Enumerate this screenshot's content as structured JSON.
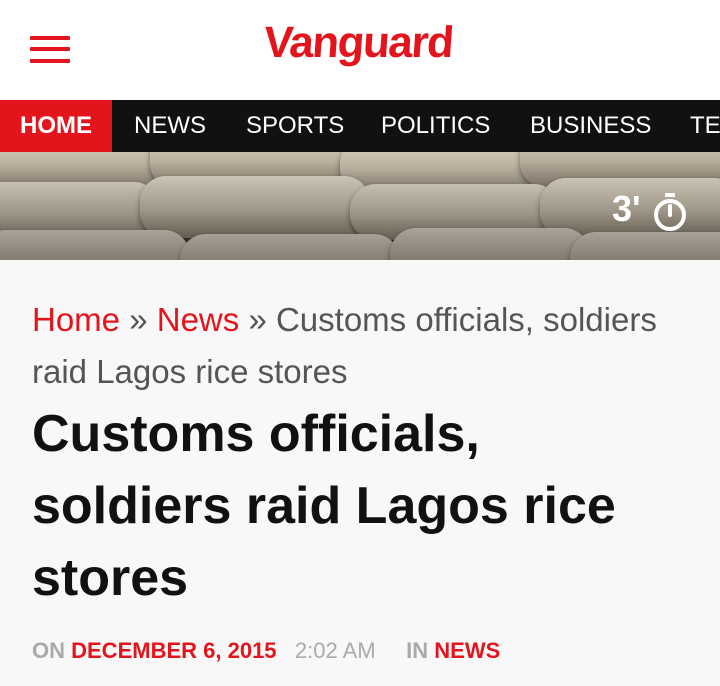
{
  "header": {
    "logo_text": "Vanguard"
  },
  "nav": {
    "items": [
      "HOME",
      "NEWS",
      "SPORTS",
      "POLITICS",
      "BUSINESS",
      "TE"
    ]
  },
  "hero": {
    "read_time": "3'"
  },
  "breadcrumb": {
    "home": "Home",
    "sep": "»",
    "news": "News",
    "current": "Customs officials, soldiers raid Lagos rice stores"
  },
  "article": {
    "title": "Customs officials, soldiers raid Lagos rice stores",
    "meta": {
      "on_label": "ON",
      "date": "DECEMBER 6, 2015",
      "time": "2:02 AM",
      "in_label": "IN",
      "category": "NEWS"
    }
  },
  "colors": {
    "brand_red": "#e4141d",
    "nav_bg": "#111111"
  }
}
